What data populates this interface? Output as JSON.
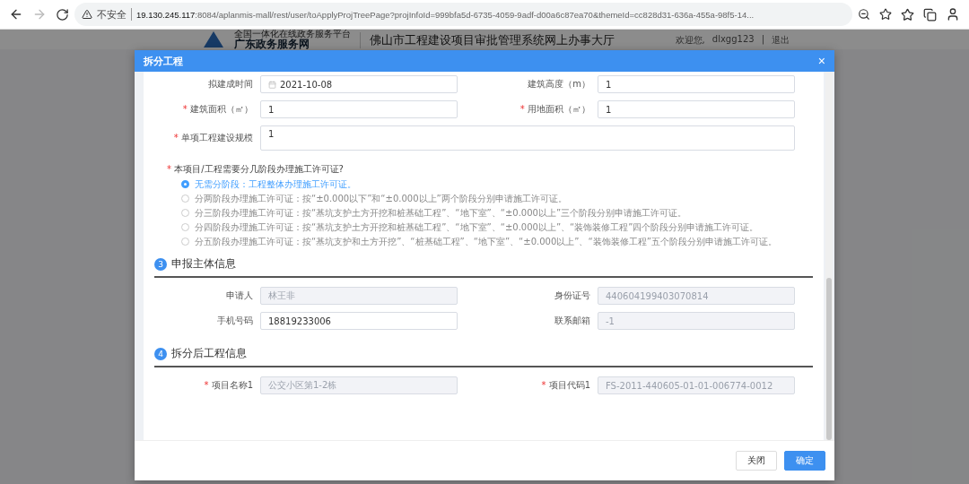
{
  "browser": {
    "back_disabled": false,
    "forward_disabled": true,
    "security": "不安全",
    "url_host": "19.130.245.117",
    "url_rest": ":8084/aplanmis-mall/rest/user/toApplyProjTreePage?projInfoId=999bfa5d-6735-4059-9adf-d00a6c87ea70&themeId=cc828d31-636a-455a-98f5-14..."
  },
  "site": {
    "platform": "全国一体化在线政务服务平台",
    "brand": "广东政务服务网",
    "title": "佛山市工程建设项目审批管理系统网上办事大厅",
    "welcome": "欢迎您,",
    "user": "dlxgg123",
    "separator": "|",
    "logout": "退出"
  },
  "modal": {
    "title": "拆分工程",
    "close": "×",
    "required_mark": "*",
    "fields": [
      {
        "kind": "date",
        "label": "拟建成时间",
        "value": "2021-10-08",
        "required": false,
        "disabled": false
      },
      {
        "kind": "input",
        "label": "建筑高度（m）",
        "value": "1",
        "required": false,
        "disabled": false
      },
      {
        "kind": "input",
        "label": "建筑面积（㎡）",
        "value": "1",
        "required": true,
        "disabled": false
      },
      {
        "kind": "input",
        "label": "用地面积（㎡）",
        "value": "1",
        "required": true,
        "disabled": false
      },
      {
        "kind": "textarea",
        "label": "单项工程建设规模",
        "value": "1",
        "required": true,
        "disabled": false
      }
    ],
    "question": {
      "label": "本项目/工程需要分几阶段办理施工许可证?",
      "required": true
    },
    "options": [
      {
        "label": "无需分阶段：工程整体办理施工许可证。",
        "selected": true
      },
      {
        "label": "分两阶段办理施工许可证：按“±0.000以下”和“±0.000以上”两个阶段分别申请施工许可证。",
        "selected": false
      },
      {
        "label": "分三阶段办理施工许可证：按“基坑支护土方开挖和桩基础工程”、“地下室”、“±0.000以上”三个阶段分别申请施工许可证。",
        "selected": false
      },
      {
        "label": "分四阶段办理施工许可证：按“基坑支护土方开挖和桩基础工程”、“地下室”、“±0.000以上”、“装饰装修工程”四个阶段分别申请施工许可证。",
        "selected": false
      },
      {
        "label": "分五阶段办理施工许可证：按“基坑支护和土方开挖”、“桩基础工程”、“地下室”、“±0.000以上”、“装饰装修工程”五个阶段分别申请施工许可证。",
        "selected": false
      }
    ],
    "sections": [
      {
        "number": "3",
        "title": "申报主体信息",
        "fields": [
          {
            "label": "申请人",
            "value": "林王非",
            "required": false,
            "disabled": true
          },
          {
            "label": "身份证号",
            "value": "440604199403070814",
            "required": false,
            "disabled": true
          },
          {
            "label": "手机号码",
            "value": "18819233006",
            "required": false,
            "disabled": false
          },
          {
            "label": "联系邮箱",
            "value": "-1",
            "required": false,
            "disabled": true
          }
        ]
      },
      {
        "number": "4",
        "title": "拆分后工程信息",
        "fields": [
          {
            "label": "项目名称1",
            "value": "公交小区第1-2栋",
            "required": true,
            "disabled": true
          },
          {
            "label": "项目代码1",
            "value": "FS-2011-440605-01-01-006774-0012",
            "required": true,
            "disabled": true
          }
        ]
      }
    ],
    "buttons": [
      {
        "label": "关闭",
        "kind": "secondary"
      },
      {
        "label": "确定",
        "kind": "primary"
      }
    ]
  }
}
